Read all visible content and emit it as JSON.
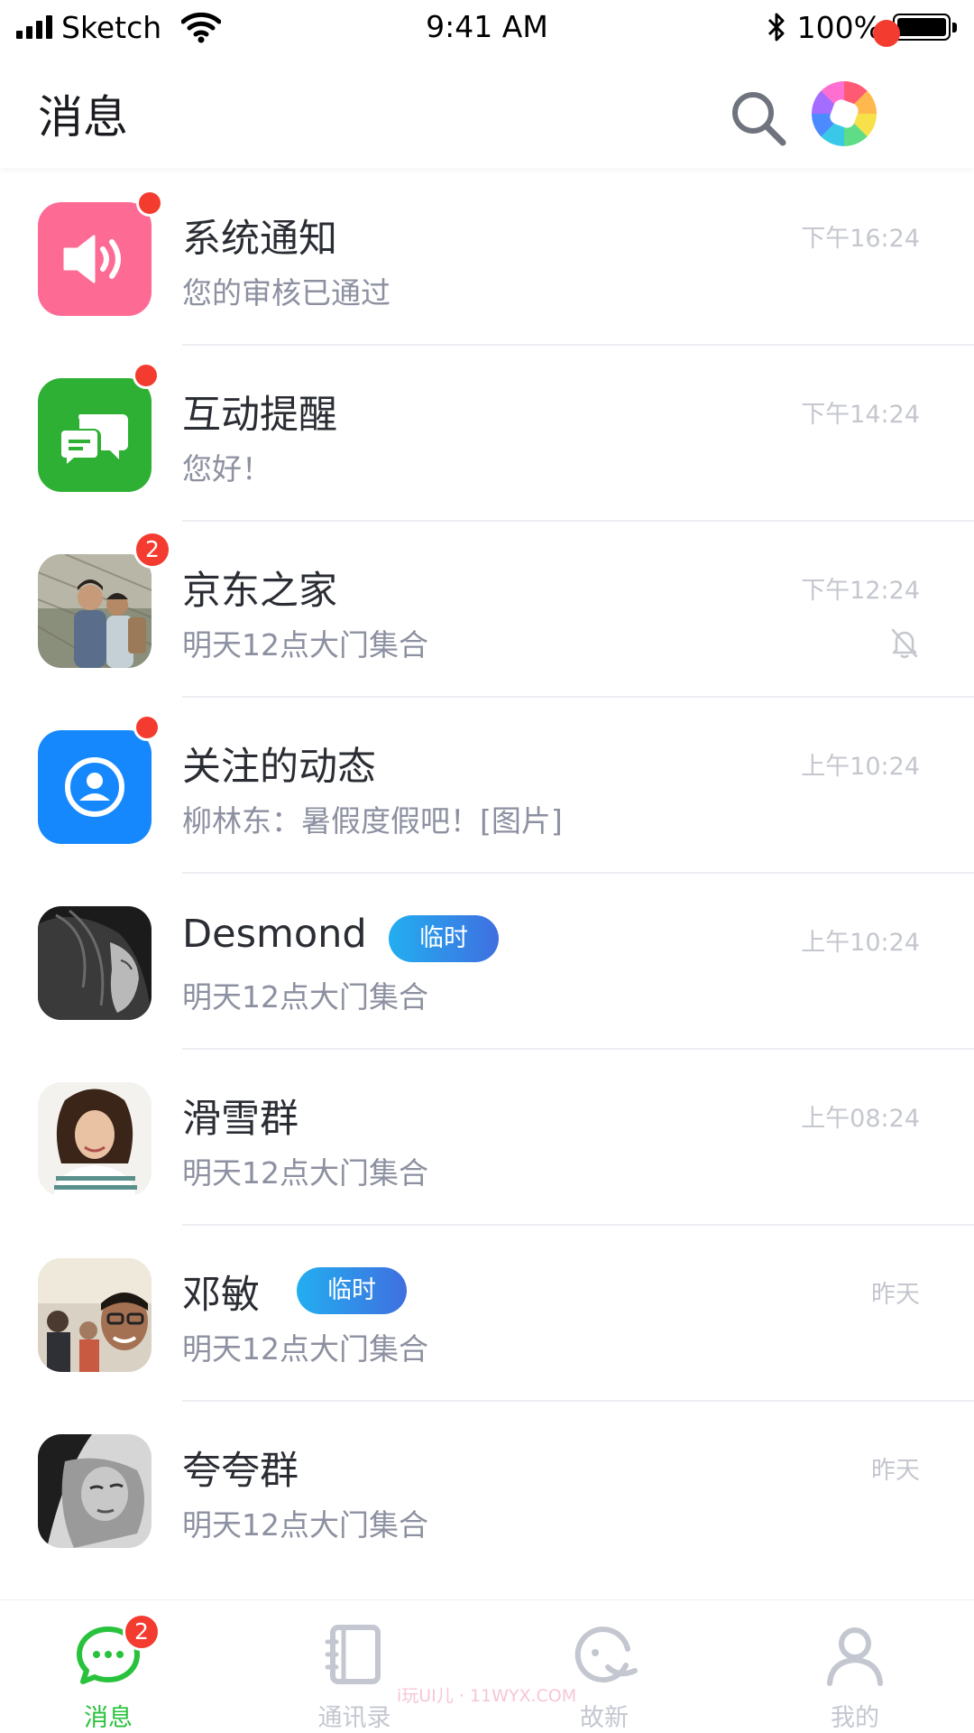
{
  "status_bar": {
    "carrier": "Sketch",
    "time": "9:41 AM",
    "battery": "100%"
  },
  "header": {
    "title": "消息",
    "search_icon": "search-icon",
    "camera_icon": "camera-shutter-icon"
  },
  "conversations": [
    {
      "name": "系统通知",
      "snippet": "您的审核已通过",
      "time": "下午16:24",
      "avatar": "speaker-icon",
      "avatar_color": "#fd6b95",
      "unread_dot": true
    },
    {
      "name": "互动提醒",
      "snippet": "您好！",
      "time": "下午14:24",
      "avatar": "chat-bubbles-icon",
      "avatar_color": "#2db033",
      "unread_dot": true
    },
    {
      "name": "京东之家",
      "snippet": "明天12点大门集合",
      "time": "下午12:24",
      "avatar": "group-photo",
      "unread_count": "2",
      "muted": true
    },
    {
      "name": "关注的动态",
      "snippet": "柳林东：暑假度假吧！[图片]",
      "time": "上午10:24",
      "avatar": "person-circle-icon",
      "avatar_color": "#1688fe",
      "unread_dot": true
    },
    {
      "name": "Desmond",
      "tag": "临时",
      "snippet": "明天12点大门集合",
      "time": "上午10:24",
      "avatar": "user-photo"
    },
    {
      "name": "滑雪群",
      "snippet": "明天12点大门集合",
      "time": "上午08:24",
      "avatar": "user-photo"
    },
    {
      "name": "邓敏",
      "tag": "临时",
      "snippet": "明天12点大门集合",
      "time": "昨天",
      "avatar": "user-photo"
    },
    {
      "name": "夸夸群",
      "snippet": "明天12点大门集合",
      "time": "昨天",
      "avatar": "user-photo"
    }
  ],
  "tab_bar": {
    "tabs": [
      {
        "label": "消息",
        "icon": "chat-icon",
        "active": true,
        "badge": "2"
      },
      {
        "label": "通讯录",
        "icon": "contacts-book-icon",
        "active": false
      },
      {
        "label": "故新",
        "icon": "discover-icon",
        "active": false
      },
      {
        "label": "我的",
        "icon": "profile-icon",
        "active": false
      }
    ],
    "active_color": "#28c23c",
    "inactive_color": "#c4c7d0"
  },
  "watermark": "i玩UI儿 · 11WYX.COM"
}
